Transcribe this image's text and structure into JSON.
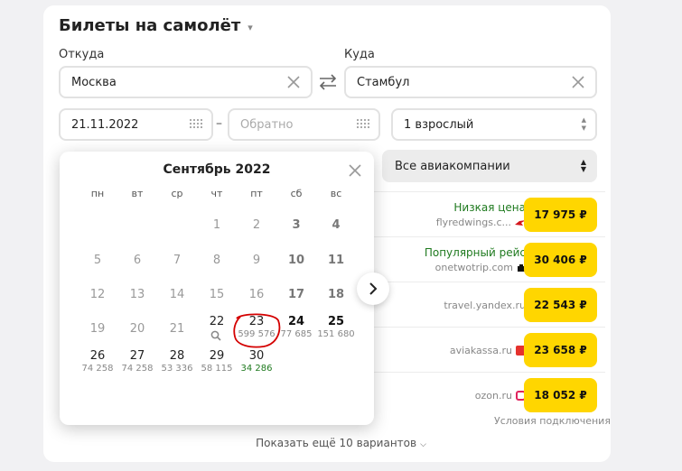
{
  "header": {
    "title": "Билеты на самолёт",
    "caret": "▾"
  },
  "form": {
    "from_label": "Откуда",
    "to_label": "Куда",
    "from_value": "Москва",
    "to_value": "Стамбул",
    "depart_date": "21.11.2022",
    "return_placeholder": "Обратно",
    "date_separator": "–",
    "passengers": "1 взрослый",
    "airlines": "Все авиакомпании"
  },
  "calendar": {
    "month_title": "Сентябрь 2022",
    "weekdays": [
      "пн",
      "вт",
      "ср",
      "чт",
      "пт",
      "сб",
      "вс"
    ],
    "row1": {
      "d1": "1",
      "d2": "2",
      "d3": "3",
      "d4": "4"
    },
    "row2": {
      "d5": "5",
      "d6": "6",
      "d7": "7",
      "d8": "8",
      "d9": "9",
      "d10": "10",
      "d11": "11"
    },
    "row3": {
      "d12": "12",
      "d13": "13",
      "d14": "14",
      "d15": "15",
      "d16": "16",
      "d17": "17",
      "d18": "18"
    },
    "row4": {
      "d19": "19",
      "d20": "20",
      "d21": "21",
      "d22": "22",
      "d23": "23",
      "p23": "599 576",
      "d24": "24",
      "p24": "77 685",
      "d25": "25",
      "p25": "151 680"
    },
    "row5": {
      "d26": "26",
      "p26": "74 258",
      "d27": "27",
      "p27": "74 258",
      "d28": "28",
      "p28": "53 336",
      "d29": "29",
      "p29": "58 115",
      "d30": "30",
      "p30": "34 286"
    }
  },
  "offers": [
    {
      "name": "Низкая цена",
      "site": "flyredwings.c...",
      "price": "17 975 ₽"
    },
    {
      "name": "Популярный рейс",
      "site": "onetwotrip.com",
      "price": "30 406 ₽"
    },
    {
      "name": "",
      "site": "travel.yandex.ru",
      "price": "22 543 ₽"
    },
    {
      "name": "",
      "site": "aviakassa.ru",
      "price": "23 658 ₽"
    },
    {
      "name": "",
      "site": "ozon.ru",
      "price": "18 052 ₽"
    }
  ],
  "footer": {
    "conditions": "Условия подключения",
    "show_more": "Показать ещё 10 вариантов"
  },
  "colors": {
    "price_bg": "#ffd600",
    "highlight_text": "#1f7a1f",
    "annotation": "#d40000"
  }
}
